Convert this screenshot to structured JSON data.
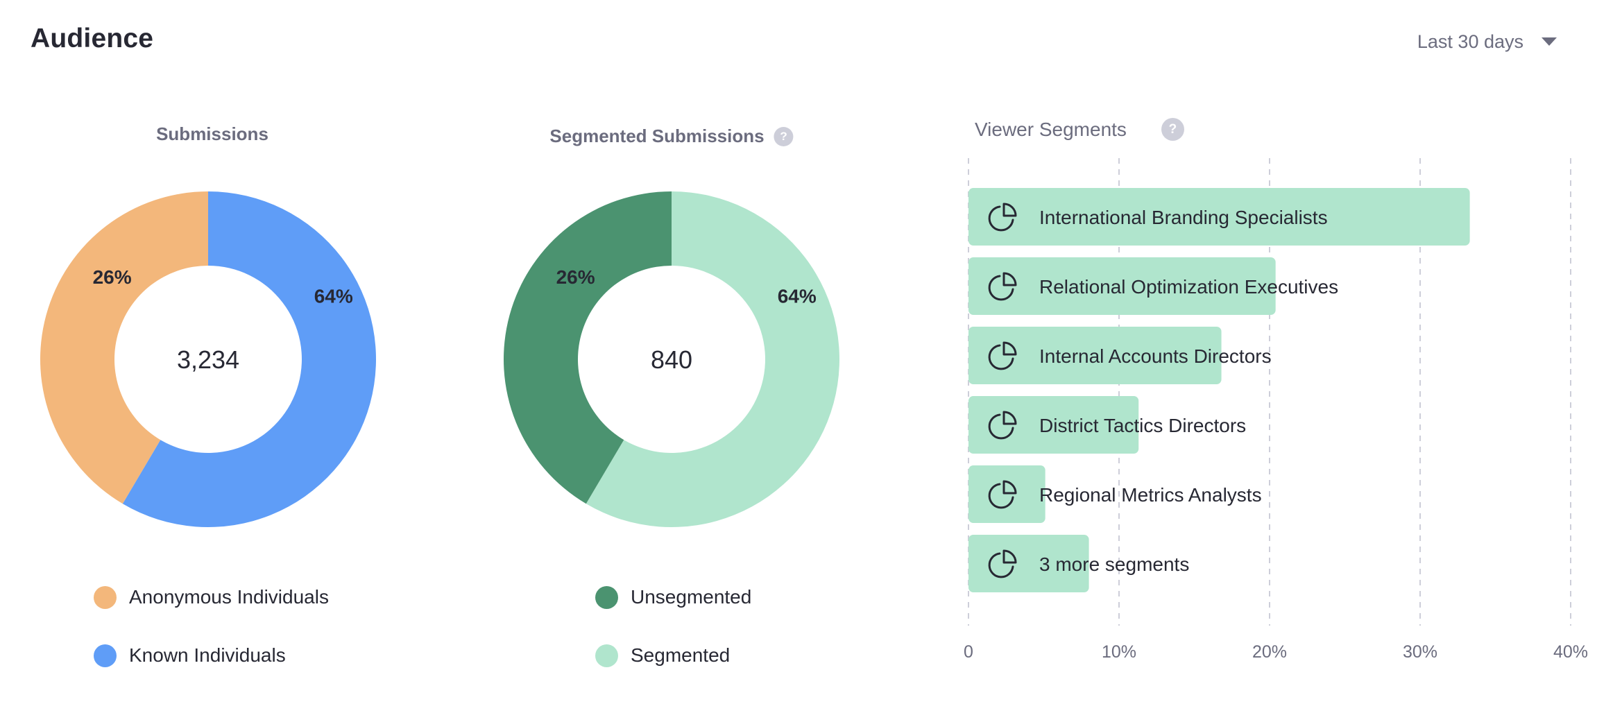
{
  "header": {
    "title": "Audience",
    "range_label": "Last 30 days"
  },
  "chart_data": [
    {
      "type": "pie",
      "title": "Submissions",
      "has_help": false,
      "center_value": "3,234",
      "slices": [
        {
          "name": "Known Individuals",
          "label": "64%",
          "visual_share": 0.585,
          "color": "#5F9DF7"
        },
        {
          "name": "Anonymous Individuals",
          "label": "26%",
          "visual_share": 0.415,
          "color": "#F3B77B"
        }
      ],
      "legend": [
        {
          "name": "Anonymous Individuals",
          "color": "#F3B77B"
        },
        {
          "name": "Known Individuals",
          "color": "#5F9DF7"
        }
      ],
      "legend_position": "bottom"
    },
    {
      "type": "pie",
      "title": "Segmented Submissions",
      "has_help": true,
      "center_value": "840",
      "slices": [
        {
          "name": "Segmented",
          "label": "64%",
          "visual_share": 0.585,
          "color": "#B0E5CD"
        },
        {
          "name": "Unsegmented",
          "label": "26%",
          "visual_share": 0.415,
          "color": "#4B9370"
        }
      ],
      "legend": [
        {
          "name": "Unsegmented",
          "color": "#4B9370"
        },
        {
          "name": "Segmented",
          "color": "#B0E5CD"
        }
      ],
      "legend_position": "bottom"
    },
    {
      "type": "bar",
      "orientation": "horizontal",
      "title": "Viewer Segments",
      "has_help": true,
      "categories": [
        "International Branding Specialists",
        "Relational Optimization Executives",
        "Internal Accounts Directors",
        "District Tactics Directors",
        "Regional Metrics Analysts",
        "3 more segments"
      ],
      "values": [
        33.3,
        20.4,
        16.8,
        11.3,
        5.1,
        8.0
      ],
      "unit": "%",
      "xlim": [
        0,
        40
      ],
      "xticks": [
        "0",
        "10%",
        "20%",
        "30%",
        "40%"
      ],
      "xtick_values": [
        0,
        10,
        20,
        30,
        40
      ],
      "grid": "vertical-dashed",
      "bar_color": "#B0E5CD",
      "bar_icon": "pie-chart-icon",
      "xlabel": "",
      "ylabel": ""
    }
  ]
}
